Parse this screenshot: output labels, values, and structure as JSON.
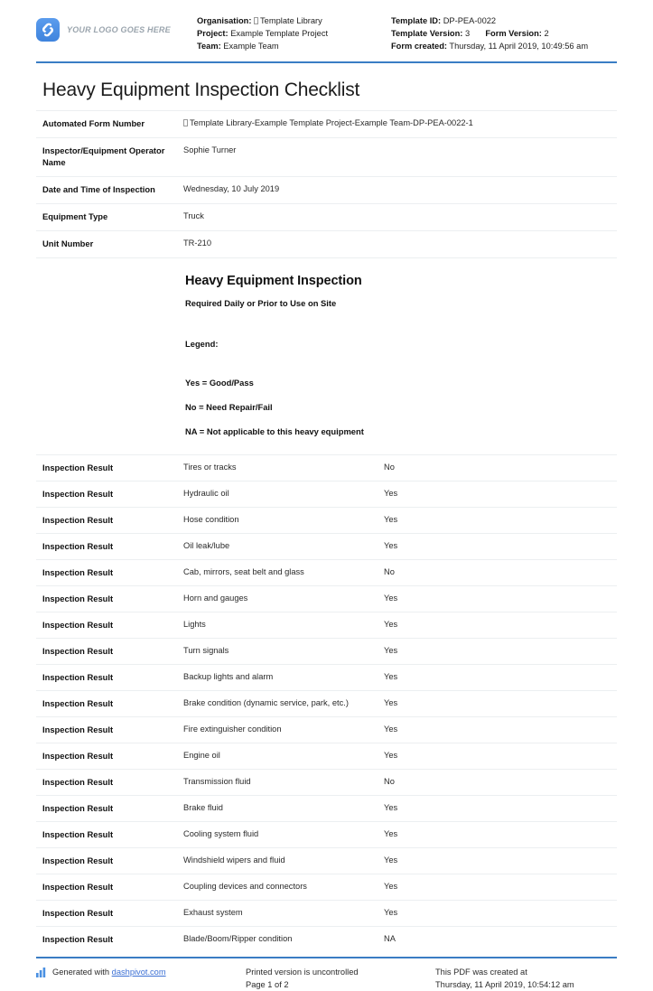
{
  "header": {
    "logo_text": "YOUR LOGO GOES HERE",
    "left": {
      "organisation_label": "Organisation:",
      "organisation_value": "Template Library",
      "project_label": "Project:",
      "project_value": "Example Template Project",
      "team_label": "Team:",
      "team_value": "Example Team"
    },
    "right": {
      "template_id_label": "Template ID:",
      "template_id_value": "DP-PEA-0022",
      "template_version_label": "Template Version:",
      "template_version_value": "3",
      "form_version_label": "Form Version:",
      "form_version_value": "2",
      "form_created_label": "Form created:",
      "form_created_value": "Thursday, 11 April 2019, 10:49:56 am"
    }
  },
  "title": "Heavy Equipment Inspection Checklist",
  "info_rows": [
    {
      "label": "Automated Form Number",
      "value": "Template Library-Example Template Project-Example Team-DP-PEA-0022-1",
      "has_tofu": true
    },
    {
      "label": "Inspector/Equipment Operator Name",
      "value": "Sophie Turner",
      "has_tofu": false
    },
    {
      "label": "Date and Time of Inspection",
      "value": "Wednesday, 10 July 2019",
      "has_tofu": false
    },
    {
      "label": "Equipment Type",
      "value": "Truck",
      "has_tofu": false
    },
    {
      "label": "Unit Number",
      "value": "TR-210",
      "has_tofu": false
    }
  ],
  "section": {
    "title": "Heavy Equipment Inspection",
    "subtitle": "Required Daily or Prior to Use on Site",
    "legend_label": "Legend:",
    "legend_items": [
      "Yes = Good/Pass",
      "No = Need Repair/Fail",
      "NA = Not applicable to this heavy equipment"
    ]
  },
  "result_label": "Inspection Result",
  "results": [
    {
      "item": "Tires or tracks",
      "value": "No"
    },
    {
      "item": "Hydraulic oil",
      "value": "Yes"
    },
    {
      "item": "Hose condition",
      "value": "Yes"
    },
    {
      "item": "Oil leak/lube",
      "value": "Yes"
    },
    {
      "item": "Cab, mirrors, seat belt and glass",
      "value": "No"
    },
    {
      "item": "Horn and gauges",
      "value": "Yes"
    },
    {
      "item": "Lights",
      "value": "Yes"
    },
    {
      "item": "Turn signals",
      "value": "Yes"
    },
    {
      "item": "Backup lights and alarm",
      "value": "Yes"
    },
    {
      "item": "Brake condition (dynamic service, park, etc.)",
      "value": "Yes"
    },
    {
      "item": "Fire extinguisher condition",
      "value": "Yes"
    },
    {
      "item": "Engine oil",
      "value": "Yes"
    },
    {
      "item": "Transmission fluid",
      "value": "No"
    },
    {
      "item": "Brake fluid",
      "value": "Yes"
    },
    {
      "item": "Cooling system fluid",
      "value": "Yes"
    },
    {
      "item": "Windshield wipers and fluid",
      "value": "Yes"
    },
    {
      "item": "Coupling devices and connectors",
      "value": "Yes"
    },
    {
      "item": "Exhaust system",
      "value": "Yes"
    },
    {
      "item": "Blade/Boom/Ripper condition",
      "value": "NA"
    }
  ],
  "footer": {
    "generated_prefix": "Generated with",
    "generated_link": "dashpivot.com",
    "printed_notice": "Printed version is uncontrolled",
    "page_number": "Page 1 of 2",
    "created_notice": "This PDF was created at",
    "created_timestamp": "Thursday, 11 April 2019, 10:54:12 am"
  },
  "colors": {
    "accent_blue": "#3a7dc4",
    "logo_blue": "#4a90e2",
    "link_blue": "#3b6fd4",
    "rule_gray": "#eceff1"
  }
}
